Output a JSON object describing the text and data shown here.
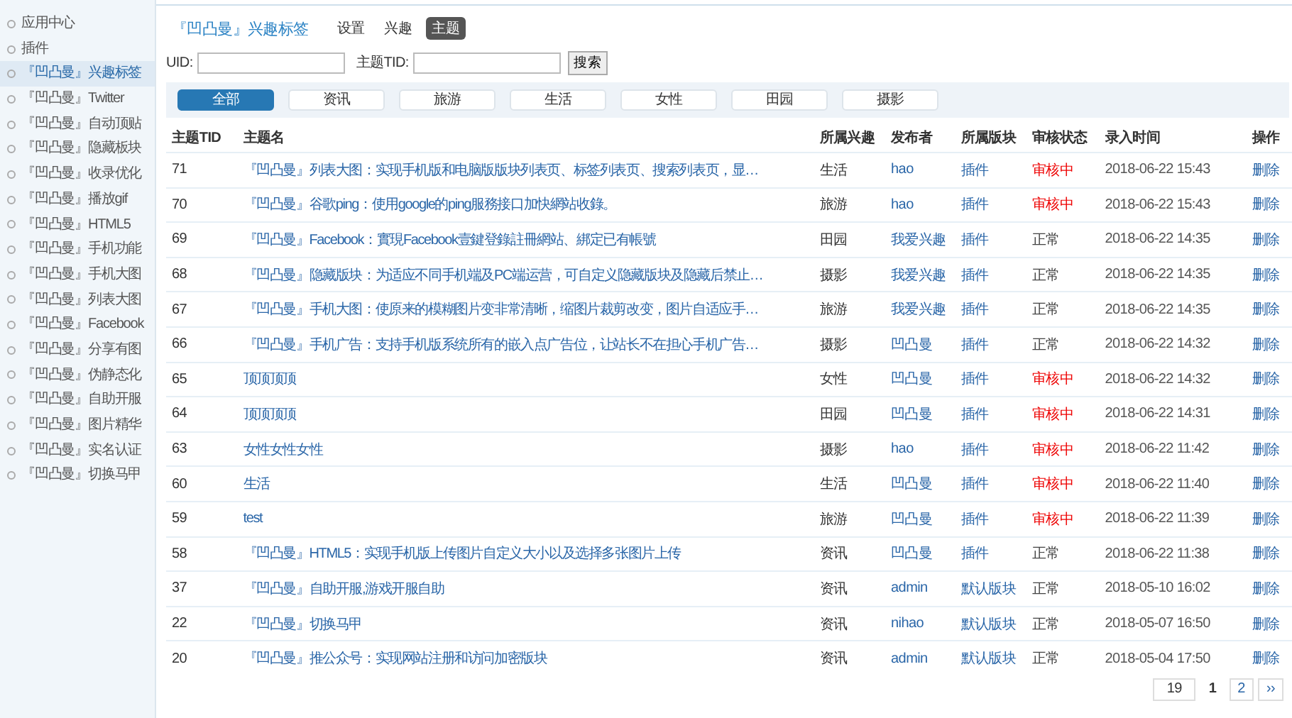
{
  "sidebar": {
    "items": [
      {
        "label": "应用中心",
        "selected": false
      },
      {
        "label": "插件",
        "selected": false
      },
      {
        "label": "『凹凸曼』兴趣标签",
        "selected": true
      },
      {
        "label": "『凹凸曼』Twitter",
        "selected": false
      },
      {
        "label": "『凹凸曼』自动顶贴",
        "selected": false
      },
      {
        "label": "『凹凸曼』隐藏板块",
        "selected": false
      },
      {
        "label": "『凹凸曼』收录优化",
        "selected": false
      },
      {
        "label": "『凹凸曼』播放gif",
        "selected": false
      },
      {
        "label": "『凹凸曼』HTML5",
        "selected": false
      },
      {
        "label": "『凹凸曼』手机功能",
        "selected": false
      },
      {
        "label": "『凹凸曼』手机大图",
        "selected": false
      },
      {
        "label": "『凹凸曼』列表大图",
        "selected": false
      },
      {
        "label": "『凹凸曼』Facebook",
        "selected": false
      },
      {
        "label": "『凹凸曼』分享有图",
        "selected": false
      },
      {
        "label": "『凹凸曼』伪静态化",
        "selected": false
      },
      {
        "label": "『凹凸曼』自助开服",
        "selected": false
      },
      {
        "label": "『凹凸曼』图片精华",
        "selected": false
      },
      {
        "label": "『凹凸曼』实名认证",
        "selected": false
      },
      {
        "label": "『凹凸曼』切换马甲",
        "selected": false
      }
    ]
  },
  "header": {
    "title": "『凹凸曼』兴趣标签",
    "tabs": [
      {
        "label": "设置",
        "selected": false
      },
      {
        "label": "兴趣",
        "selected": false
      },
      {
        "label": "主题",
        "selected": true
      }
    ]
  },
  "search": {
    "uid_label": "UID:",
    "tid_label": "主题TID:",
    "button": "搜索"
  },
  "categories": [
    {
      "label": "全部",
      "selected": true
    },
    {
      "label": "资讯",
      "selected": false
    },
    {
      "label": "旅游",
      "selected": false
    },
    {
      "label": "生活",
      "selected": false
    },
    {
      "label": "女性",
      "selected": false
    },
    {
      "label": "田园",
      "selected": false
    },
    {
      "label": "摄影",
      "selected": false
    }
  ],
  "table": {
    "columns": [
      "主题TID",
      "主题名",
      "所属兴趣",
      "发布者",
      "所属版块",
      "审核状态",
      "录入时间",
      "操作"
    ],
    "rows": [
      {
        "tid": "71",
        "name": "『凹凸曼』列表大图：实现手机版和电脑版版块列表页、标签列表页、搜索列表页，显…",
        "interest": "生活",
        "author": "hao",
        "forum": "插件",
        "status": "审核中",
        "pending": true,
        "time": "2018-06-22 15:43",
        "action": "删除"
      },
      {
        "tid": "70",
        "name": "『凹凸曼』谷歌ping：使用google的ping服務接口加快網站收錄。",
        "interest": "旅游",
        "author": "hao",
        "forum": "插件",
        "status": "审核中",
        "pending": true,
        "time": "2018-06-22 15:43",
        "action": "删除"
      },
      {
        "tid": "69",
        "name": "『凹凸曼』Facebook：實現Facebook壹鍵登錄註冊網站、綁定已有帳號",
        "interest": "田园",
        "author": "我爱兴趣",
        "forum": "插件",
        "status": "正常",
        "pending": false,
        "time": "2018-06-22 14:35",
        "action": "删除"
      },
      {
        "tid": "68",
        "name": "『凹凸曼』隐藏版块：为适应不同手机端及PC端运营，可自定义隐藏版块及隐藏后禁止…",
        "interest": "摄影",
        "author": "我爱兴趣",
        "forum": "插件",
        "status": "正常",
        "pending": false,
        "time": "2018-06-22 14:35",
        "action": "删除"
      },
      {
        "tid": "67",
        "name": "『凹凸曼』手机大图：使原来的模糊图片变非常清晰，缩图片裁剪改变，图片自适应手…",
        "interest": "旅游",
        "author": "我爱兴趣",
        "forum": "插件",
        "status": "正常",
        "pending": false,
        "time": "2018-06-22 14:35",
        "action": "删除"
      },
      {
        "tid": "66",
        "name": "『凹凸曼』手机广告：支持手机版系统所有的嵌入点广告位，让站长不在担心手机广告…",
        "interest": "摄影",
        "author": "凹凸曼",
        "forum": "插件",
        "status": "正常",
        "pending": false,
        "time": "2018-06-22 14:32",
        "action": "删除"
      },
      {
        "tid": "65",
        "name": "顶顶顶顶",
        "interest": "女性",
        "author": "凹凸曼",
        "forum": "插件",
        "status": "审核中",
        "pending": true,
        "time": "2018-06-22 14:32",
        "action": "删除"
      },
      {
        "tid": "64",
        "name": "顶顶顶顶",
        "interest": "田园",
        "author": "凹凸曼",
        "forum": "插件",
        "status": "审核中",
        "pending": true,
        "time": "2018-06-22 14:31",
        "action": "删除"
      },
      {
        "tid": "63",
        "name": "女性女性女性",
        "interest": "摄影",
        "author": "hao",
        "forum": "插件",
        "status": "审核中",
        "pending": true,
        "time": "2018-06-22 11:42",
        "action": "删除"
      },
      {
        "tid": "60",
        "name": "生活",
        "interest": "生活",
        "author": "凹凸曼",
        "forum": "插件",
        "status": "审核中",
        "pending": true,
        "time": "2018-06-22 11:40",
        "action": "删除"
      },
      {
        "tid": "59",
        "name": "test",
        "interest": "旅游",
        "author": "凹凸曼",
        "forum": "插件",
        "status": "审核中",
        "pending": true,
        "time": "2018-06-22 11:39",
        "action": "删除"
      },
      {
        "tid": "58",
        "name": "『凹凸曼』HTML5：实现手机版上传图片自定义大小以及选择多张图片上传",
        "interest": "资讯",
        "author": "凹凸曼",
        "forum": "插件",
        "status": "正常",
        "pending": false,
        "time": "2018-06-22 11:38",
        "action": "删除"
      },
      {
        "tid": "37",
        "name": "『凹凸曼』自助开服,游戏开服自助",
        "interest": "资讯",
        "author": "admin",
        "forum": "默认版块",
        "status": "正常",
        "pending": false,
        "time": "2018-05-10 16:02",
        "action": "删除"
      },
      {
        "tid": "22",
        "name": "『凹凸曼』切换马甲",
        "interest": "资讯",
        "author": "nihao",
        "forum": "默认版块",
        "status": "正常",
        "pending": false,
        "time": "2018-05-07 16:50",
        "action": "删除"
      },
      {
        "tid": "20",
        "name": "『凹凸曼』推公众号：实现网站注册和访问加密版块",
        "interest": "资讯",
        "author": "admin",
        "forum": "默认版块",
        "status": "正常",
        "pending": false,
        "time": "2018-05-04 17:50",
        "action": "删除"
      }
    ]
  },
  "pagination": {
    "total": "19",
    "pages": [
      {
        "label": "1",
        "selected": true
      },
      {
        "label": "2",
        "selected": false
      }
    ],
    "next": "››"
  }
}
